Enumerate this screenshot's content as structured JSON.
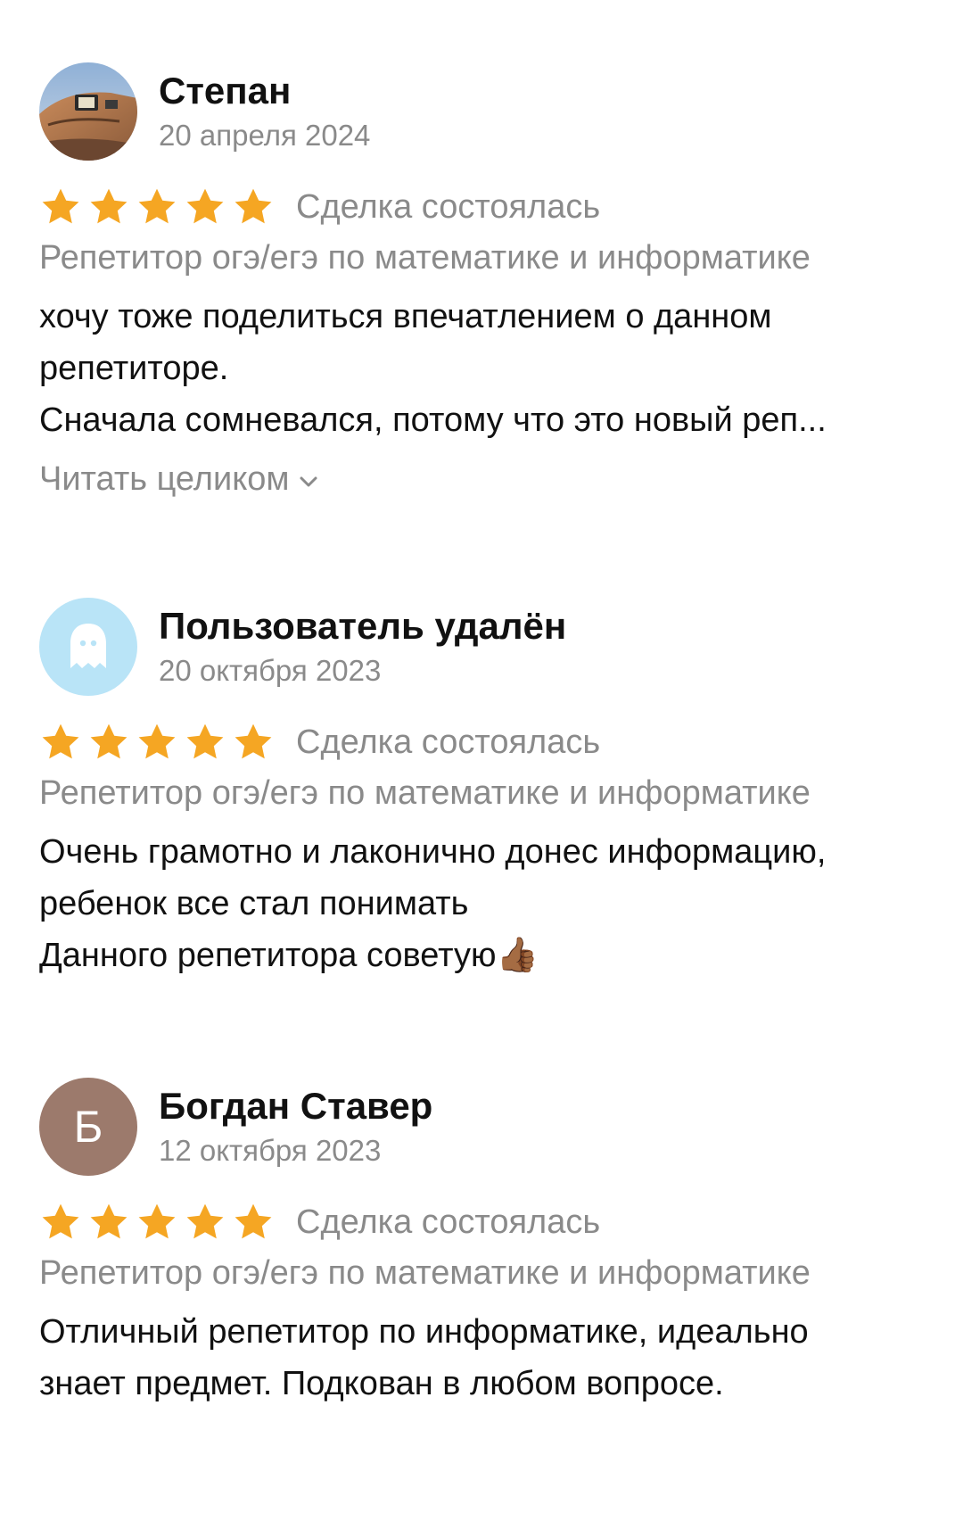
{
  "accent_colors": {
    "star": "#F5A623",
    "secondary_text": "#8A8A8A",
    "avatar_letter_bg": "#9C7A6C",
    "avatar_ghost_bg": "#B9E4F7"
  },
  "reviews": [
    {
      "author": "Степан",
      "date": "20 апреля 2024",
      "rating": 5,
      "deal_status": "Сделка состоялась",
      "subject": "Репетитор огэ/егэ по математике и информатике",
      "text_lines": [
        "хочу тоже поделиться впечатлением о данном",
        "репетиторе.",
        "Сначала сомневался, потому что это новый реп..."
      ],
      "read_more": "Читать целиком",
      "avatar_icon": "photo-avatar"
    },
    {
      "author": "Пользователь удалён",
      "date": "20 октября 2023",
      "rating": 5,
      "deal_status": "Сделка состоялась",
      "subject": "Репетитор огэ/егэ по математике и информатике",
      "text_lines": [
        "Очень грамотно и лаконично донес информацию,",
        "ребенок все стал понимать",
        "Данного репетитора советую👍🏾"
      ],
      "avatar_icon": "ghost-icon"
    },
    {
      "author": "Богдан Ставер",
      "date": "12 октября 2023",
      "avatar_letter": "Б",
      "rating": 5,
      "deal_status": "Сделка состоялась",
      "subject": "Репетитор огэ/егэ по математике и информатике",
      "text_lines": [
        "Отличный репетитор по информатике,  идеально",
        "знает предмет. Подкован в любом вопросе."
      ]
    }
  ]
}
